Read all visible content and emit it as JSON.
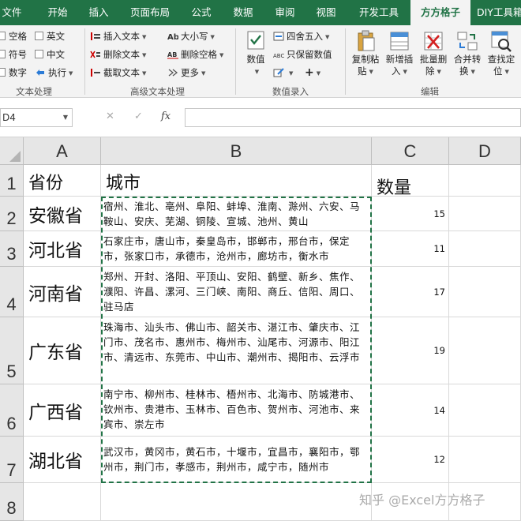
{
  "ribbon_tabs": [
    {
      "label": "文件",
      "active": false
    },
    {
      "label": "开始",
      "active": false
    },
    {
      "label": "插入",
      "active": false
    },
    {
      "label": "页面布局",
      "active": false
    },
    {
      "label": "公式",
      "active": false
    },
    {
      "label": "数据",
      "active": false
    },
    {
      "label": "审阅",
      "active": false
    },
    {
      "label": "视图",
      "active": false
    },
    {
      "label": "开发工具",
      "active": false
    },
    {
      "label": "方方格子",
      "active": true
    },
    {
      "label": "DIY工具箱",
      "active": false
    }
  ],
  "text_group": {
    "name": "文本处理",
    "checkboxes": [
      "空格",
      "英文",
      "符号",
      "中文",
      "数字"
    ],
    "execute": "执行"
  },
  "adv_text_group": {
    "name": "高级文本处理",
    "insert_text": "插入文本",
    "delete_text": "删除文本",
    "extract_text": "截取文本",
    "case": "大小写",
    "delete_space": "删除空格",
    "more": "更多"
  },
  "num_group": {
    "name": "数值录入",
    "value": "数值",
    "round": "四舍五入",
    "keep_num": "只保留数值",
    "plus": "+"
  },
  "edit_group": {
    "name": "编辑",
    "btn1": [
      "复制粘",
      "贴"
    ],
    "btn2": [
      "新增插",
      "入"
    ],
    "btn3": [
      "批量删",
      "除"
    ],
    "btn4": [
      "合并转",
      "换"
    ],
    "btn5": [
      "查找定",
      "位"
    ]
  },
  "formula_bar": {
    "name_box": "D4",
    "cancel": "✕",
    "enter": "✓",
    "fx": "fx",
    "value": ""
  },
  "columns": [
    "A",
    "B",
    "C",
    "D"
  ],
  "row_numbers": [
    "1",
    "2",
    "3",
    "4",
    "5",
    "6",
    "7",
    "8"
  ],
  "header_row": {
    "province": "省份",
    "city": "城市",
    "count": "数量"
  },
  "rows": [
    {
      "province": "安徽省",
      "cities": "宿州、淮北、亳州、阜阳、蚌埠、淮南、滁州、六安、马鞍山、安庆、芜湖、铜陵、宣城、池州、黄山",
      "count": "15"
    },
    {
      "province": "河北省",
      "cities": "石家庄市，唐山市，秦皇岛市，邯郸市，邢台市，保定市，张家口市，承德市，沧州市，廊坊市，衡水市",
      "count": "11"
    },
    {
      "province": "河南省",
      "cities": "郑州、开封、洛阳、平顶山、安阳、鹤壁、新乡、焦作、濮阳、许昌、漯河、三门峡、南阳、商丘、信阳、周口、驻马店",
      "count": "17"
    },
    {
      "province": "广东省",
      "cities": "珠海市、汕头市、佛山市、韶关市、湛江市、肇庆市、江门市、茂名市、惠州市、梅州市、汕尾市、河源市、阳江市、清远市、东莞市、中山市、潮州市、揭阳市、云浮市",
      "count": "19"
    },
    {
      "province": "广西省",
      "cities": "南宁市、柳州市、桂林市、梧州市、北海市、防城港市、钦州市、贵港市、玉林市、百色市、贺州市、河池市、来宾市、崇左市",
      "count": "14"
    },
    {
      "province": "湖北省",
      "cities": "武汉市，黄冈市，黄石市，十堰市，宜昌市，襄阳市，鄂州市，荆门市，孝感市，荆州市，咸宁市，随州市",
      "count": "12"
    }
  ],
  "watermark": "知乎 @Excel方方格子",
  "colors": {
    "accent": "#217346",
    "marquee": "#217346"
  }
}
